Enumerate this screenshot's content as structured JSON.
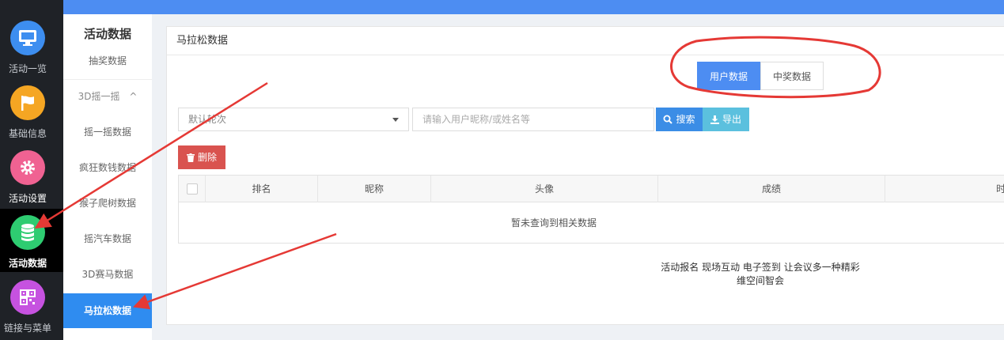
{
  "rail": {
    "items": [
      {
        "label": "活动一览",
        "icon": "monitor-icon",
        "color": "#3d8ef0"
      },
      {
        "label": "基础信息",
        "icon": "flag-icon",
        "color": "#f5a623"
      },
      {
        "label": "活动设置",
        "icon": "gear-icon",
        "color": "#f06292"
      },
      {
        "label": "活动数据",
        "icon": "database-icon",
        "color": "#2ecc71"
      },
      {
        "label": "链接与菜单",
        "icon": "qrcode-icon",
        "color": "#c652e0"
      }
    ]
  },
  "subnav": {
    "title": "活动数据",
    "items": [
      {
        "label": "抽奖数据"
      },
      {
        "label": "3D摇一摇",
        "caret": "^"
      },
      {
        "label": "摇一摇数据"
      },
      {
        "label": "疯狂数钱数据"
      },
      {
        "label": "猴子爬树数据"
      },
      {
        "label": "摇汽车数据"
      },
      {
        "label": "3D赛马数据"
      },
      {
        "label": "马拉松数据"
      }
    ]
  },
  "card": {
    "title": "马拉松数据",
    "tabs": [
      {
        "label": "用户数据",
        "active": true
      },
      {
        "label": "中奖数据",
        "active": false
      }
    ],
    "round_select": "默认轮次",
    "search_placeholder": "请输入用户昵称/或姓名等",
    "search_label": "搜索",
    "export_label": "导出",
    "delete_label": "删除",
    "columns": [
      "排名",
      "昵称",
      "头像",
      "成绩",
      "时间"
    ],
    "empty_text": "暂未查询到相关数据"
  },
  "footer": {
    "line1": "活动报名 现场互动 电子签到 让会议多一种精彩",
    "line2": "维空间智会"
  },
  "colors": {
    "accent": "#4d8df2",
    "danger": "#d9534f",
    "info": "#5bc0de",
    "annotation": "#e53935"
  }
}
